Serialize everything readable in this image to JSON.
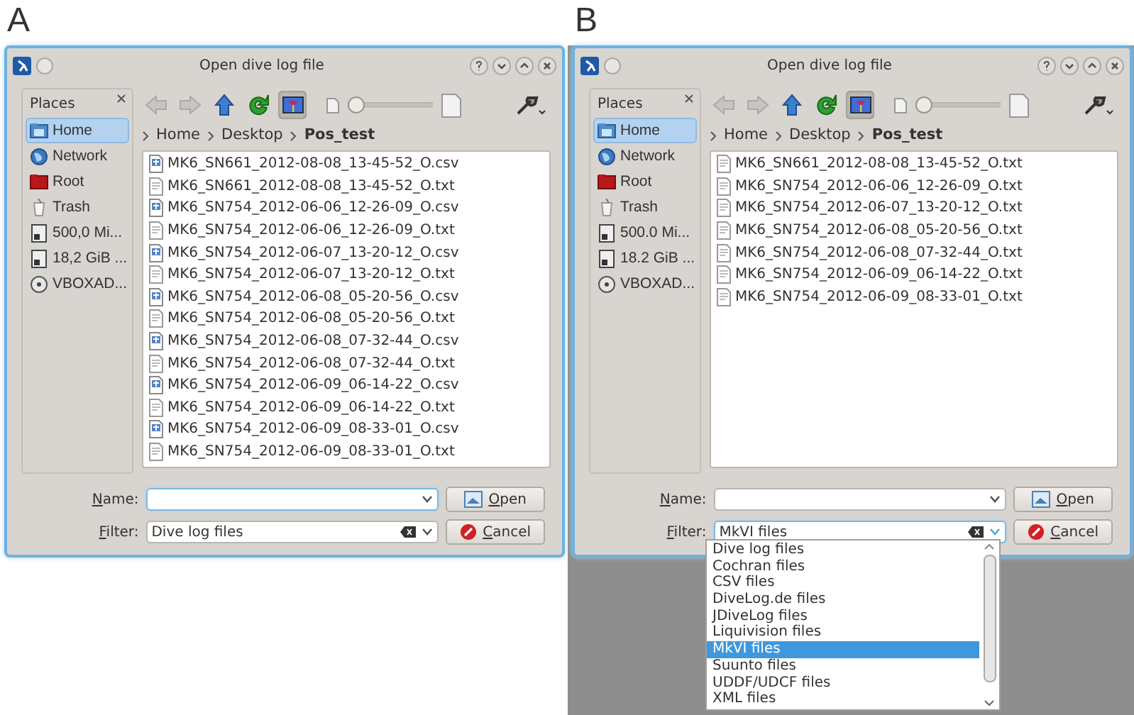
{
  "panels": [
    {
      "label": "A",
      "desktop_visible": false,
      "dialog": {
        "title": "Open dive log file",
        "places_title": "Places",
        "places": [
          {
            "label": "Home",
            "kind": "home",
            "selected": true
          },
          {
            "label": "Network",
            "kind": "network",
            "selected": false
          },
          {
            "label": "Root",
            "kind": "root",
            "selected": false
          },
          {
            "label": "Trash",
            "kind": "trash",
            "selected": false
          },
          {
            "label": "500,0 Mi...",
            "kind": "drive",
            "selected": false
          },
          {
            "label": "18,2 GiB ...",
            "kind": "drive",
            "selected": false
          },
          {
            "label": "VBOXAD...",
            "kind": "disc",
            "selected": false
          }
        ],
        "preview_on": true,
        "zoom": {
          "level": 0
        },
        "path": [
          "Home",
          "Desktop",
          "Pos_test"
        ],
        "files": [
          {
            "name": "MK6_SN661_2012-08-08_13-45-52_O.csv",
            "kind": "csv"
          },
          {
            "name": "MK6_SN661_2012-08-08_13-45-52_O.txt",
            "kind": "txt"
          },
          {
            "name": "MK6_SN754_2012-06-06_12-26-09_O.csv",
            "kind": "csv"
          },
          {
            "name": "MK6_SN754_2012-06-06_12-26-09_O.txt",
            "kind": "txt"
          },
          {
            "name": "MK6_SN754_2012-06-07_13-20-12_O.csv",
            "kind": "csv"
          },
          {
            "name": "MK6_SN754_2012-06-07_13-20-12_O.txt",
            "kind": "txt"
          },
          {
            "name": "MK6_SN754_2012-06-08_05-20-56_O.csv",
            "kind": "csv"
          },
          {
            "name": "MK6_SN754_2012-06-08_05-20-56_O.txt",
            "kind": "txt"
          },
          {
            "name": "MK6_SN754_2012-06-08_07-32-44_O.csv",
            "kind": "csv"
          },
          {
            "name": "MK6_SN754_2012-06-08_07-32-44_O.txt",
            "kind": "txt"
          },
          {
            "name": "MK6_SN754_2012-06-09_06-14-22_O.csv",
            "kind": "csv"
          },
          {
            "name": "MK6_SN754_2012-06-09_06-14-22_O.txt",
            "kind": "txt"
          },
          {
            "name": "MK6_SN754_2012-06-09_08-33-01_O.csv",
            "kind": "csv"
          },
          {
            "name": "MK6_SN754_2012-06-09_08-33-01_O.txt",
            "kind": "txt"
          }
        ],
        "name_label": "Name:",
        "name_field": {
          "focused": true
        },
        "filter_label": "Filter:",
        "filter_field": {
          "value": "Dive log files",
          "focused": false
        },
        "open_button": "Open",
        "cancel_button": "Cancel"
      }
    },
    {
      "label": "B",
      "desktop_visible": true,
      "dialog": {
        "title": "Open dive log file",
        "places_title": "Places",
        "places": [
          {
            "label": "Home",
            "kind": "home",
            "selected": true
          },
          {
            "label": "Network",
            "kind": "network",
            "selected": false
          },
          {
            "label": "Root",
            "kind": "root",
            "selected": false
          },
          {
            "label": "Trash",
            "kind": "trash",
            "selected": false
          },
          {
            "label": "500.0 Mi...",
            "kind": "drive",
            "selected": false
          },
          {
            "label": "18.2 GiB ...",
            "kind": "drive",
            "selected": false
          },
          {
            "label": "VBOXAD...",
            "kind": "disc",
            "selected": false
          }
        ],
        "preview_on": true,
        "zoom": {
          "level": 0
        },
        "path": [
          "Home",
          "Desktop",
          "Pos_test"
        ],
        "files": [
          {
            "name": "MK6_SN661_2012-08-08_13-45-52_O.txt",
            "kind": "txt"
          },
          {
            "name": "MK6_SN754_2012-06-06_12-26-09_O.txt",
            "kind": "txt"
          },
          {
            "name": "MK6_SN754_2012-06-07_13-20-12_O.txt",
            "kind": "txt"
          },
          {
            "name": "MK6_SN754_2012-06-08_05-20-56_O.txt",
            "kind": "txt"
          },
          {
            "name": "MK6_SN754_2012-06-08_07-32-44_O.txt",
            "kind": "txt"
          },
          {
            "name": "MK6_SN754_2012-06-09_06-14-22_O.txt",
            "kind": "txt"
          },
          {
            "name": "MK6_SN754_2012-06-09_08-33-01_O.txt",
            "kind": "txt"
          }
        ],
        "name_label": "Name:",
        "name_field": {
          "focused": false
        },
        "filter_label": "Filter:",
        "filter_field": {
          "value": "MkVI files",
          "focused": true
        },
        "open_button": "Open",
        "cancel_button": "Cancel",
        "filter_dropdown": {
          "options": [
            {
              "label": "Dive log files",
              "selected": false
            },
            {
              "label": "Cochran files",
              "selected": false
            },
            {
              "label": "CSV files",
              "selected": false
            },
            {
              "label": "DiveLog.de files",
              "selected": false
            },
            {
              "label": "JDiveLog files",
              "selected": false
            },
            {
              "label": "Liquivision files",
              "selected": false
            },
            {
              "label": "MkVI files",
              "selected": true
            },
            {
              "label": "Suunto files",
              "selected": false
            },
            {
              "label": "UDDF/UDCF files",
              "selected": false
            },
            {
              "label": "XML files",
              "selected": false
            }
          ]
        }
      }
    }
  ]
}
